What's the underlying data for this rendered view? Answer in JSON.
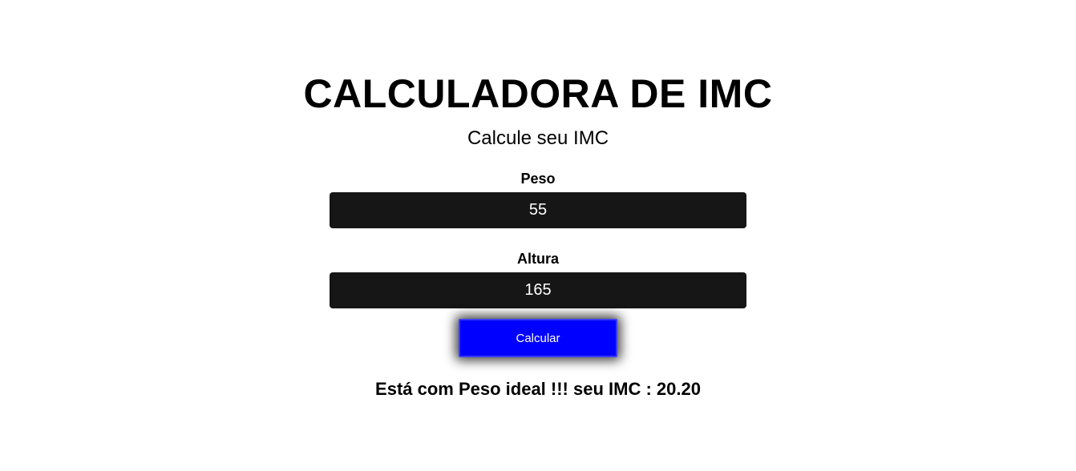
{
  "header": {
    "title": "CALCULADORA DE IMC",
    "subtitle": "Calcule seu IMC"
  },
  "form": {
    "peso": {
      "label": "Peso",
      "value": "55"
    },
    "altura": {
      "label": "Altura",
      "value": "165"
    },
    "calculate_label": "Calcular"
  },
  "result": {
    "text": "Está com Peso ideal !!! seu IMC : 20.20"
  },
  "colors": {
    "button_bg": "#0000ff",
    "input_bg": "#161616",
    "page_bg": "#ffffff"
  }
}
